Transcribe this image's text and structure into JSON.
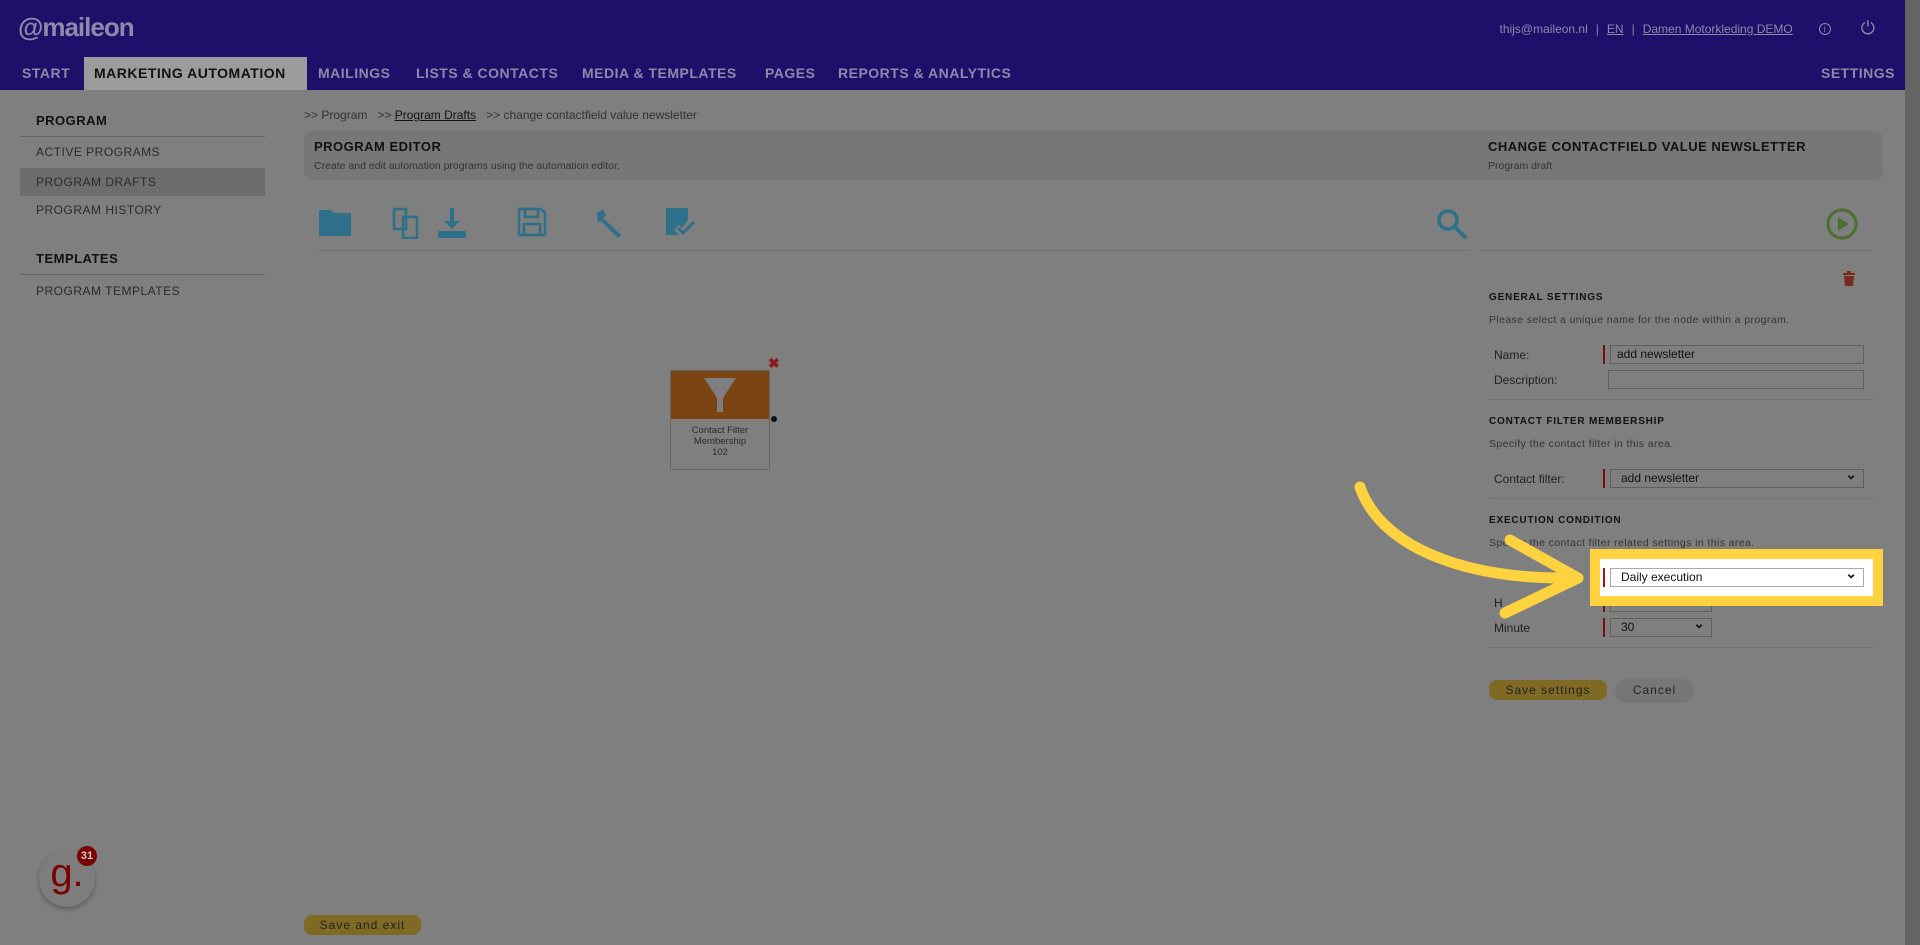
{
  "header": {
    "logo": "@maileon",
    "user": "thijs@maileon.nl",
    "lang": "EN",
    "account": "Damen Motorkleding DEMO"
  },
  "nav": [
    "START",
    "MARKETING AUTOMATION",
    "MAILINGS",
    "LISTS & CONTACTS",
    "MEDIA & TEMPLATES",
    "PAGES",
    "REPORTS & ANALYTICS"
  ],
  "nav_right": "SETTINGS",
  "sidebar": {
    "program_heading": "PROGRAM",
    "items": [
      "ACTIVE PROGRAMS",
      "PROGRAM DRAFTS",
      "PROGRAM HISTORY"
    ],
    "templates_heading": "TEMPLATES",
    "template_items": [
      "PROGRAM TEMPLATES"
    ]
  },
  "breadcrumb": {
    "a": ">> Program",
    "b_prefix": ">>",
    "b": "Program Drafts",
    "c": ">> change contactfield value newsletter"
  },
  "editor": {
    "title": "PROGRAM EDITOR",
    "subtitle": "Create and edit automation programs using the automation editor."
  },
  "program": {
    "title": "CHANGE CONTACTFIELD VALUE NEWSLETTER",
    "subtitle": "Program draft"
  },
  "node": {
    "line1": "Contact Filter",
    "line2": "Membership",
    "id": "102"
  },
  "panel": {
    "general_heading": "GENERAL SETTINGS",
    "general_text": "Please select a unique name for the node within a program.",
    "name_label": "Name:",
    "name_value": "add newsletter",
    "description_label": "Description:",
    "description_value": "",
    "filter_heading": "CONTACT FILTER MEMBERSHIP",
    "filter_text": "Specify the contact filter in this area.",
    "filter_label": "Contact filter:",
    "filter_value": "add newsletter",
    "exec_heading": "EXECUTION CONDITION",
    "exec_text": "Specify the contact filter related settings in this area.",
    "exec_value": "Daily execution",
    "hour_label": "H",
    "minute_label": "Minute",
    "minute_value": "30",
    "save": "Save settings",
    "cancel": "Cancel"
  },
  "save_exit": "Save and exit",
  "widget": {
    "letter": "g.",
    "badge": "31"
  },
  "colors": {
    "header": "#1c106b",
    "highlight": "#ffd23f",
    "node": "#7a4413",
    "accent": "#2e6f8a"
  }
}
